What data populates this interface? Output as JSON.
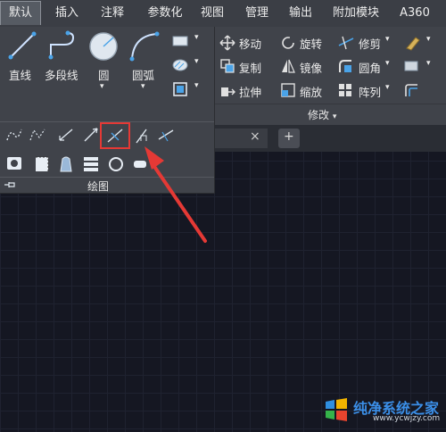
{
  "tabs": [
    "默认",
    "插入",
    "注释",
    "参数化",
    "视图",
    "管理",
    "输出",
    "附加模块",
    "A360"
  ],
  "draw": {
    "line": "直线",
    "polyline": "多段线",
    "circle": "圆",
    "arc": "圆弧",
    "panel_title": "绘图"
  },
  "modify": {
    "move": "移动",
    "rotate": "旋转",
    "trim": "修剪",
    "copy": "复制",
    "mirror": "镜像",
    "fillet": "圆角",
    "stretch": "拉伸",
    "scale": "缩放",
    "array": "阵列",
    "panel_title": "修改"
  },
  "doc_tab_close": "×",
  "doc_tab_new": "+",
  "watermark": {
    "brand": "纯净系统之家",
    "url": "www.ycwjzy.com"
  },
  "colors": {
    "highlight_box": "#e53935",
    "arrow": "#e53935",
    "accent_blue": "#4aa3e8"
  }
}
